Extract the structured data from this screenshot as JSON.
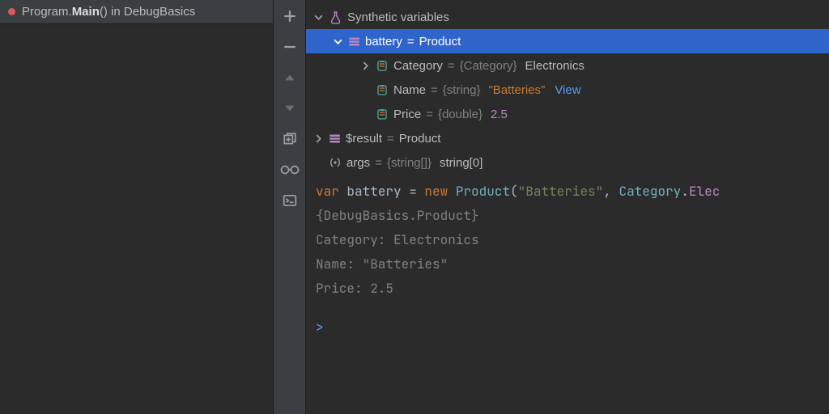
{
  "tab": {
    "prefix": "Program.",
    "bold": "Main",
    "suffix": "() in DebugBasics"
  },
  "tree": {
    "root": {
      "label": "Synthetic variables"
    },
    "battery": {
      "name": "battery",
      "eq": " = ",
      "value": "Product"
    },
    "category": {
      "name": "Category",
      "eq": " = ",
      "type": "{Category}",
      "value": "Electronics"
    },
    "name": {
      "name": "Name",
      "eq": " = ",
      "type": "{string}",
      "value": "\"Batteries\"",
      "view": "View"
    },
    "price": {
      "name": "Price",
      "eq": " = ",
      "type": "{double}",
      "value": "2.5"
    },
    "result": {
      "name": "$result",
      "eq": " = ",
      "value": "Product"
    },
    "args": {
      "name": "args",
      "eq": " = ",
      "type": "{string[]}",
      "value": "string[0]"
    }
  },
  "code": {
    "k_var": "var",
    "ident": " battery ",
    "eq": "= ",
    "k_new": "new",
    "sp": " ",
    "type": "Product",
    "open": "(",
    "str": "\"Batteries\"",
    "comma": ", ",
    "enum0": "Category",
    "dot": ".",
    "enum1": "Elec",
    "l2": "{DebugBasics.Product}",
    "l3": " Category: Electronics",
    "l4": " Name: \"Batteries\"",
    "l5": " Price: 2.5",
    "prompt": ">"
  }
}
